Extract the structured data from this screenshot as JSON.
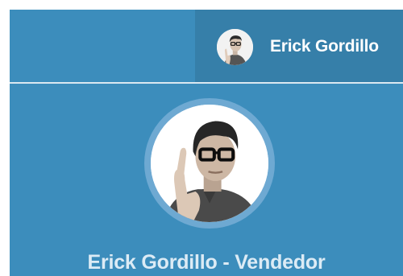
{
  "navbar": {
    "user": {
      "name": "Erick Gordillo",
      "avatar_icon": "user-avatar-photo"
    }
  },
  "profile": {
    "avatar_icon": "user-avatar-photo",
    "title": "Erick Gordillo - Vendedor"
  },
  "colors": {
    "navbar_bg": "#3c8dbc",
    "user_menu_bg": "#367fa9",
    "avatar_ring": "#6ea9d2",
    "title_text": "#dcebf5"
  }
}
